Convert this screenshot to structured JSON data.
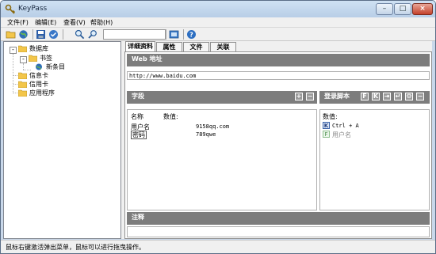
{
  "window": {
    "title": "KeyPass"
  },
  "menu": [
    "文件(F)",
    "编辑(E)",
    "查看(V)",
    "帮助(H)"
  ],
  "toolbar": {
    "search_value": ""
  },
  "tree": {
    "root": "数据库",
    "bookmarks": "书签",
    "new_entry": "新条目",
    "info_card": "信息卡",
    "credit_card": "信用卡",
    "apps": "应用程序"
  },
  "tabs": [
    "详细资料",
    "属性",
    "文件",
    "关联"
  ],
  "detail": {
    "web_header": "Web 地址",
    "url": "http://www.baidu.com",
    "fields_header": "字段",
    "col_name": "名称",
    "col_value": "数值:",
    "fields": [
      {
        "name": "用户名",
        "value": "9158qq.com"
      },
      {
        "name": "密码",
        "value": "789qwe"
      }
    ],
    "login_header": "登录脚本",
    "login_col_value": "数值:",
    "login_rows": [
      {
        "badge": "K",
        "text": "Ctrl + A"
      },
      {
        "badge": "F",
        "text": "用户名"
      }
    ],
    "notes_header": "注释"
  },
  "status": "鼠标右键激活弹出菜单，鼠标可以进行拖曳操作。",
  "colors": {
    "header_bg": "#7d7d7d",
    "titlebar": "#c9d8ea",
    "folder": "#f3c64a"
  }
}
